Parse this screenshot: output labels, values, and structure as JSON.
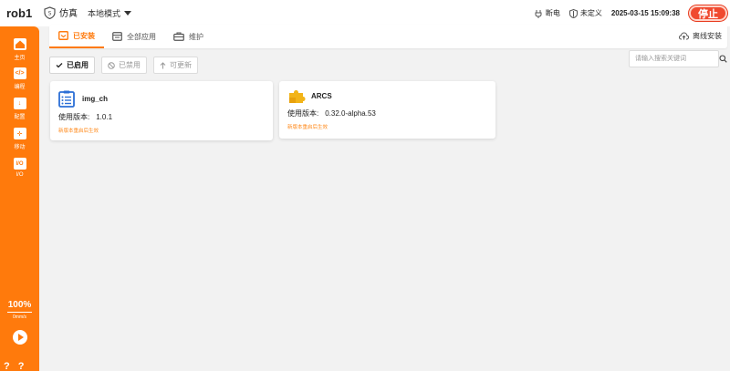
{
  "topbar": {
    "robot_name": "rob1",
    "sim_label": "仿真",
    "mode_label": "本地模式",
    "status_power": "断电",
    "status_safety": "未定义",
    "datetime": "2025-03-15 15:09:38",
    "stop_label": "停止"
  },
  "sidebar": {
    "items": [
      {
        "label": "主页",
        "icon": "home-icon",
        "glyph": "⌂"
      },
      {
        "label": "编程",
        "icon": "code-icon",
        "glyph": "</>"
      },
      {
        "label": "配置",
        "icon": "download-icon",
        "glyph": "↓"
      },
      {
        "label": "移动",
        "icon": "move-icon",
        "glyph": "✛"
      },
      {
        "label": "I/O",
        "icon": "io-icon",
        "glyph": "I/O"
      }
    ],
    "speed_value": "100%",
    "speed_unit": "0mm/s",
    "help_marks": "? ? ? ?"
  },
  "tabs": [
    {
      "label": "已安装",
      "icon": "package-icon"
    },
    {
      "label": "全部应用",
      "icon": "apps-icon"
    },
    {
      "label": "维护",
      "icon": "toolbox-icon"
    }
  ],
  "offline_install_label": "离线安装",
  "filters": [
    {
      "label": "已启用",
      "icon": "check-icon"
    },
    {
      "label": "已禁用",
      "icon": "ban-icon"
    },
    {
      "label": "可更新",
      "icon": "arrow-up-icon"
    }
  ],
  "search": {
    "placeholder": "请输入搜索关键词"
  },
  "cards": [
    {
      "name": "img_ch",
      "version_label": "使用版本:",
      "version": "1.0.1",
      "note": "新版本重启后生效"
    },
    {
      "name": "ARCS",
      "version_label": "使用版本:",
      "version": "0.32.0-alpha.53",
      "note": "新版本重启后生效"
    }
  ],
  "colors": {
    "accent": "#ff7a0c",
    "stop": "#f04a2f",
    "blue_icon": "#2b6fd6",
    "yellow_icon": "#f2b418"
  }
}
